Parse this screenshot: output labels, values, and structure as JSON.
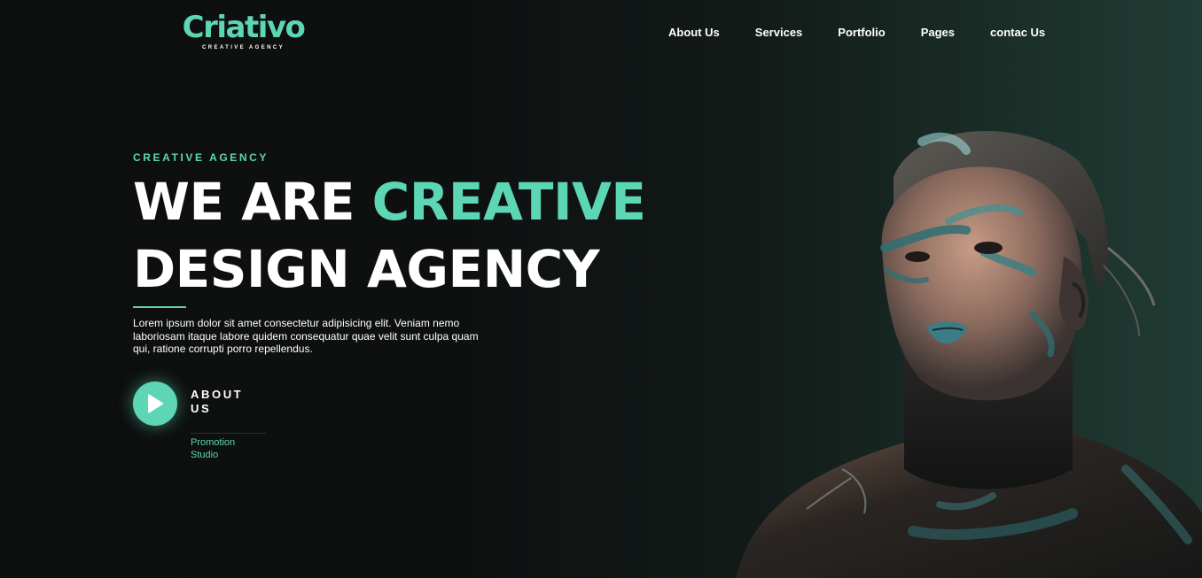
{
  "brand": {
    "name": "Criativo",
    "tagline": "CREATIVE AGENCY",
    "accent_color": "#5cd6b4"
  },
  "nav": {
    "items": [
      "About Us",
      "Services",
      "Portfolio",
      "Pages",
      "contac Us"
    ]
  },
  "hero": {
    "eyebrow": "CREATIVE AGENCY",
    "headline_part1": "WE ARE ",
    "headline_accent": "CREATIVE",
    "headline_line2": "DESIGN AGENCY",
    "description": "Lorem ipsum dolor sit amet consectetur adipisicing elit. Veniam nemo laboriosam itaque labore quidem consequatur quae velit sunt culpa quam qui, ratione corrupti porro repellendus.",
    "cta_title": "ABOUT US",
    "cta_subtitle": "Promotion Studio",
    "play_icon": "play-icon"
  },
  "image": {
    "subject": "woman-with-teal-face-paint-portrait"
  }
}
